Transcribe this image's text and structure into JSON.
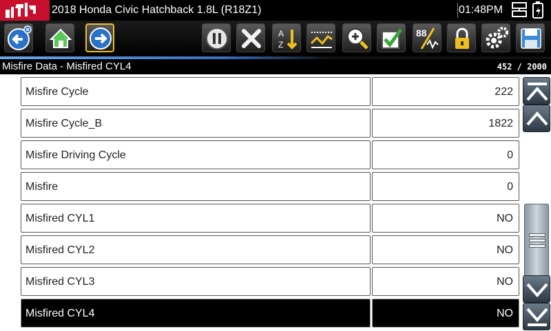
{
  "title_bar": {
    "vehicle": "2018 Honda Civic Hatchback 1.8L (R18Z1)",
    "time": "01:48PM",
    "logo_icon": "wrench-logo-icon",
    "status_icons": [
      "network-icon",
      "battery-icon"
    ],
    "accent_color": "#c8102e"
  },
  "toolbar": {
    "buttons": [
      {
        "id": "back",
        "icon": "back-arrow-icon"
      },
      {
        "id": "home",
        "icon": "home-icon"
      },
      {
        "id": "forward",
        "icon": "forward-arrow-icon",
        "selected": true
      },
      {
        "id": "pause",
        "icon": "pause-icon"
      },
      {
        "id": "clear",
        "icon": "x-icon"
      },
      {
        "id": "sort",
        "icon": "sort-az-icon"
      },
      {
        "id": "graph",
        "icon": "graph-icon"
      },
      {
        "id": "zoom",
        "icon": "zoom-icon"
      },
      {
        "id": "select",
        "icon": "checkmark-icon"
      },
      {
        "id": "units",
        "icon": "units-icon",
        "text": "88"
      },
      {
        "id": "lock",
        "icon": "lock-icon"
      },
      {
        "id": "settings",
        "icon": "gear-icon"
      },
      {
        "id": "save",
        "icon": "save-icon"
      }
    ]
  },
  "header": {
    "title": "Misfire Data - Misfired CYL4",
    "count": "452 / 2000"
  },
  "rows": [
    {
      "name": "Misfire Cycle",
      "value": "222"
    },
    {
      "name": "Misfire Cycle_B",
      "value": "1822"
    },
    {
      "name": "Misfire Driving Cycle",
      "value": "0"
    },
    {
      "name": "Misfire",
      "value": "0"
    },
    {
      "name": "Misfired CYL1",
      "value": "NO"
    },
    {
      "name": "Misfired CYL2",
      "value": "NO"
    },
    {
      "name": "Misfired CYL3",
      "value": "NO"
    },
    {
      "name": "Misfired CYL4",
      "value": "NO",
      "selected": true
    }
  ],
  "scrollbar": {
    "icons": [
      "page-top-icon",
      "scroll-up-icon",
      "scroll-down-icon",
      "page-bottom-icon"
    ],
    "position": 0.23
  }
}
